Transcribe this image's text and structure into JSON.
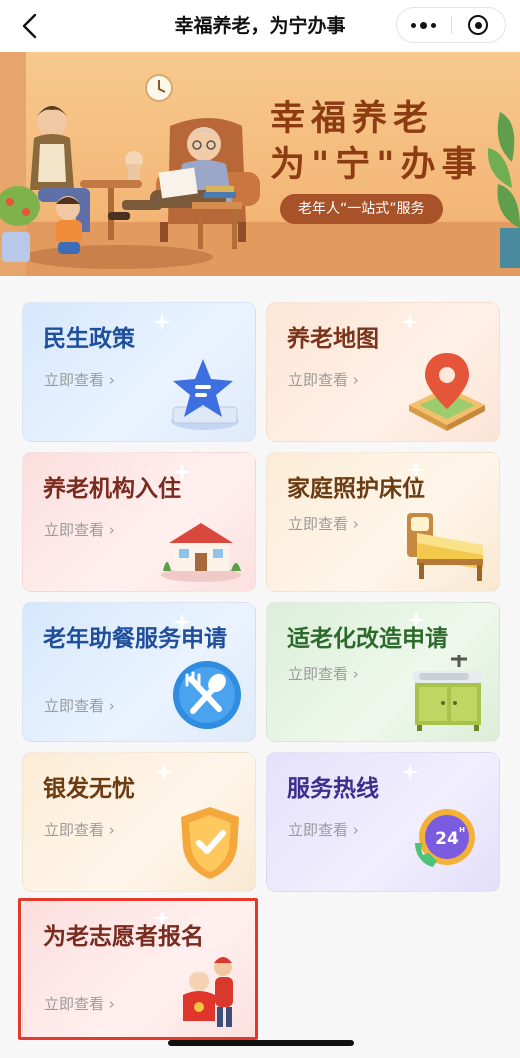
{
  "navbar": {
    "title": "幸福养老，为宁办事",
    "back_icon": "chevron-left-icon",
    "more_icon": "more-dots-icon",
    "close_icon": "target-circle-icon"
  },
  "banner": {
    "title_line1": "幸福养老",
    "title_line2": "为\"宁\"办事",
    "subtitle": "老年人“一站式”服务"
  },
  "cards": [
    {
      "title": "民生政策",
      "link": "立即查看 ›",
      "icon": "star-document-icon",
      "theme": "blue"
    },
    {
      "title": "养老地图",
      "link": "立即查看 ›",
      "icon": "map-pin-icon",
      "theme": "peach"
    },
    {
      "title": "养老机构入住",
      "link": "立即查看 ›",
      "icon": "house-icon",
      "theme": "pink"
    },
    {
      "title": "家庭照护床位",
      "link": "立即查看 ›",
      "icon": "bed-icon",
      "theme": "cream"
    },
    {
      "title": "老年助餐服务申请",
      "link": "立即查看 ›",
      "icon": "fork-spoon-icon",
      "theme": "blue"
    },
    {
      "title": "适老化改造申请",
      "link": "立即查看 ›",
      "icon": "sink-cabinet-icon",
      "theme": "green"
    },
    {
      "title": "银发无忧",
      "link": "立即查看 ›",
      "icon": "shield-check-icon",
      "theme": "cream"
    },
    {
      "title": "服务热线",
      "link": "立即查看 ›",
      "icon": "24h-phone-icon",
      "theme": "purple"
    },
    {
      "title": "为老志愿者报名",
      "link": "立即查看 ›",
      "icon": "volunteers-icon",
      "theme": "pink"
    }
  ],
  "colors": {
    "highlight_border": "#e53a2b",
    "banner_title": "#8d3b13",
    "banner_pill": "#a8522a"
  }
}
